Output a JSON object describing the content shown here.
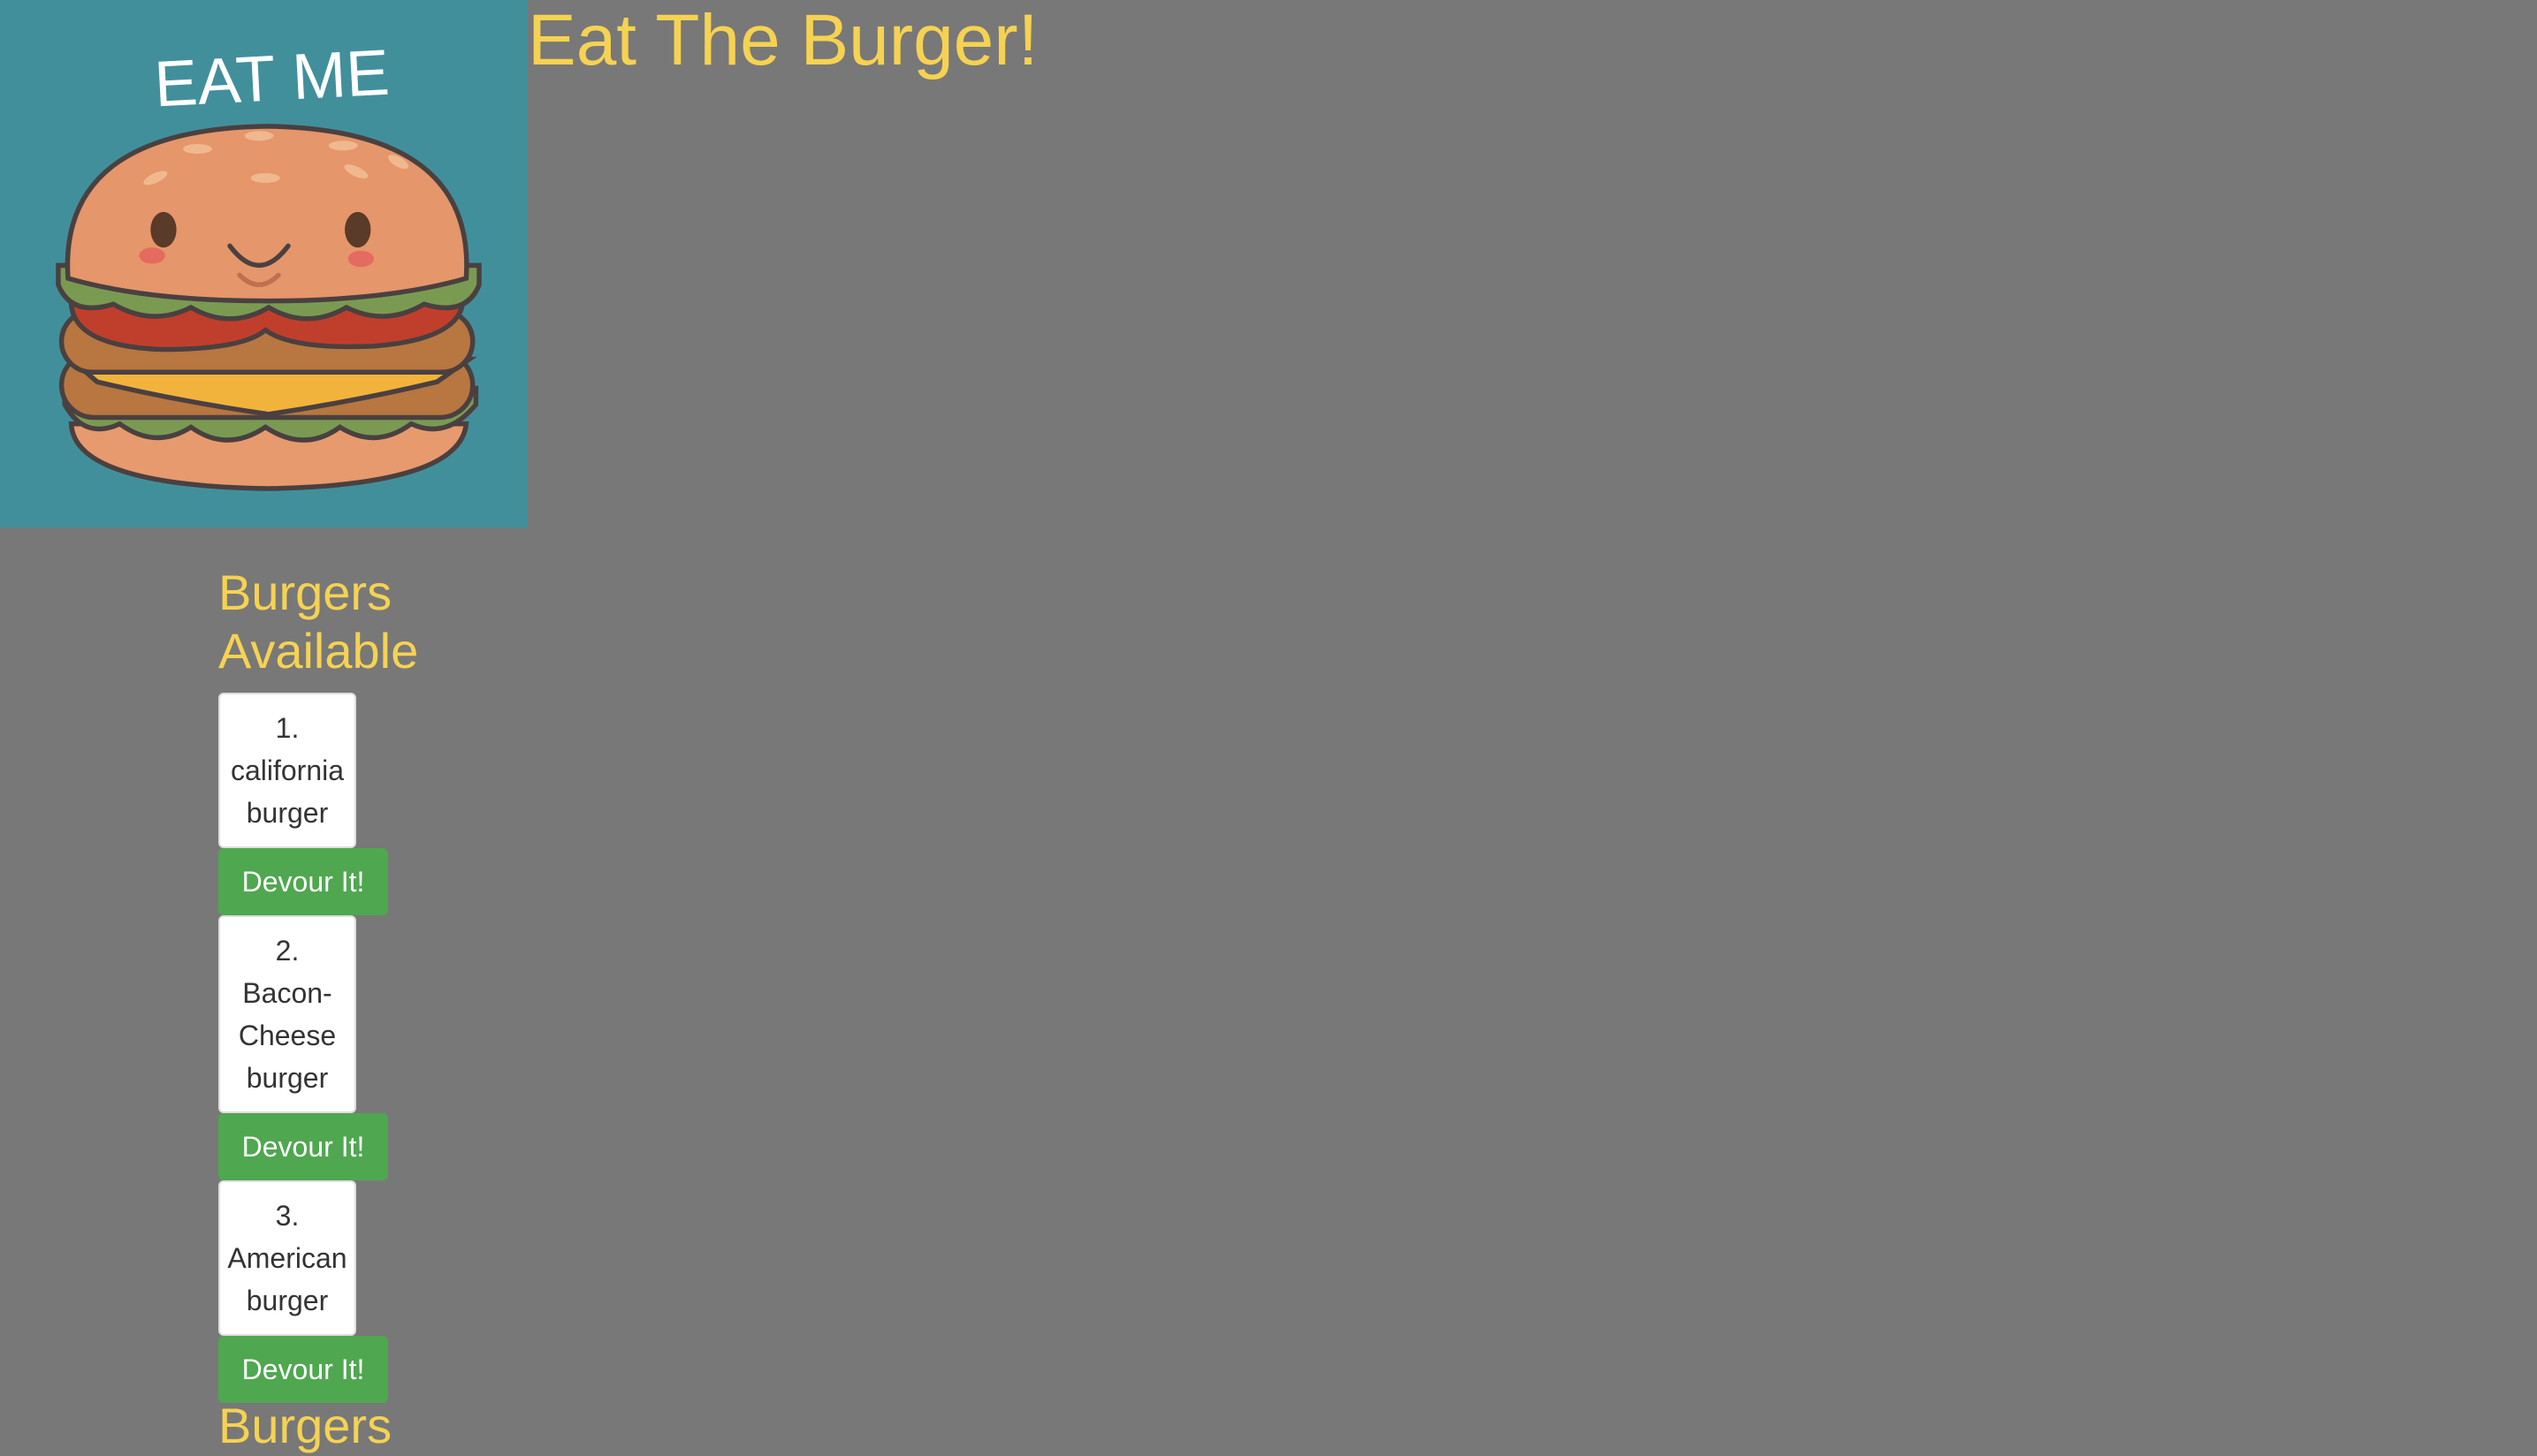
{
  "logo": {
    "text": "EAT ME",
    "background": "#428f9c"
  },
  "header": {
    "title": "Eat The Burger!"
  },
  "available": {
    "title_line1": "Burgers",
    "title_line2": "Available",
    "burgers": [
      {
        "number": "1.",
        "lines": [
          "california",
          "burger"
        ],
        "button": "Devour It!"
      },
      {
        "number": "2.",
        "lines": [
          "Bacon-",
          "Cheese",
          "burger"
        ],
        "button": "Devour It!"
      },
      {
        "number": "3.",
        "lines": [
          "American",
          "burger"
        ],
        "button": "Devour It!"
      }
    ]
  },
  "devoured": {
    "title_partial": "Burgers"
  },
  "colors": {
    "page_background": "#787878",
    "title_yellow": "#f5d252",
    "button_green": "#4fa750",
    "card_white": "#ffffff"
  }
}
